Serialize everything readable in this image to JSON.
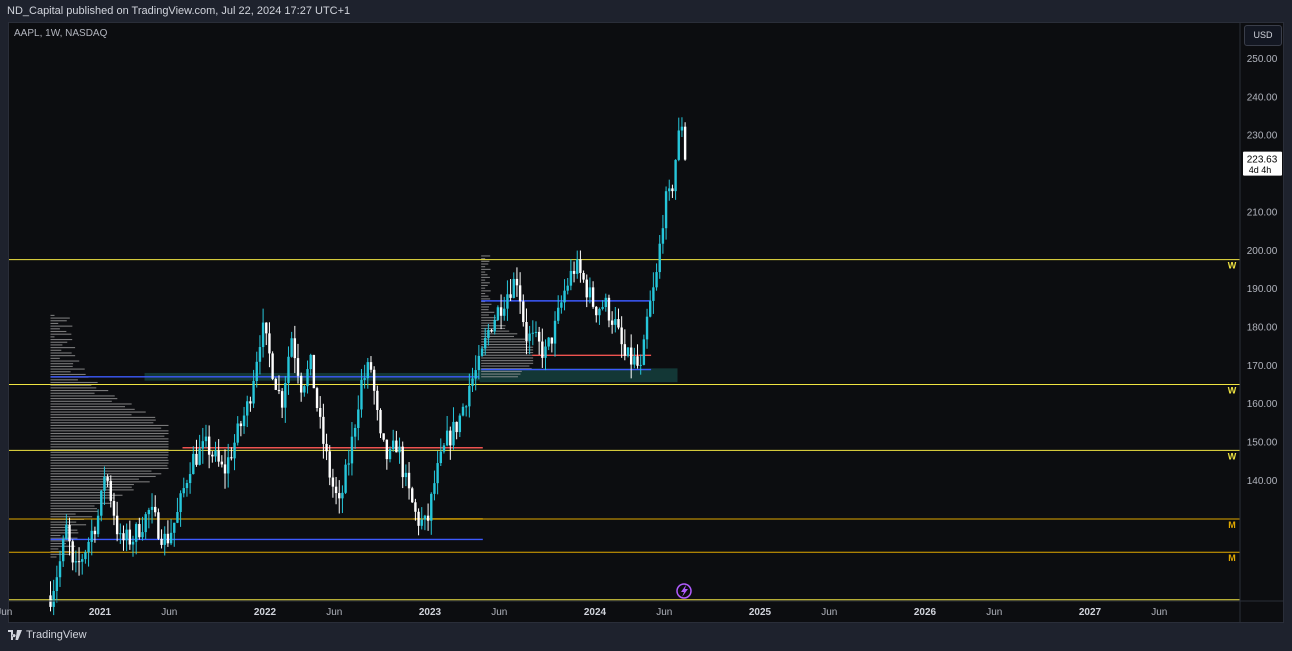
{
  "header": {
    "published_text": "ND_Capital published on TradingView.com, Jul 22, 2024 17:27 UTC+1"
  },
  "symbol": {
    "label": "AAPL, 1W, NASDAQ"
  },
  "currency": "USD",
  "footer": {
    "brand": "TradingView"
  },
  "colors": {
    "up": "#26c6da",
    "down": "#ffffff",
    "yellow_level": "#f0e442",
    "blue_level": "#3d5afe",
    "red_level": "#ef5350",
    "profile": "#9e9e9e",
    "zone": "#26a69a"
  },
  "chart_data": {
    "type": "candlestick",
    "symbol": "AAPL",
    "interval": "1W",
    "exchange": "NASDAQ",
    "ylim": [
      108.86,
      255
    ],
    "price_ticks": [
      140,
      150,
      160,
      170,
      180,
      190,
      200,
      210,
      230,
      240,
      250
    ],
    "price_tick_labels": [
      "140.00",
      "150.00",
      "160.00",
      "170.00",
      "180.00",
      "190.00",
      "200.00",
      "210.00",
      "230.00",
      "240.00",
      "250.00"
    ],
    "time_labels": [
      "Jun",
      "2021",
      "Jun",
      "2022",
      "Jun",
      "2023",
      "Jun",
      "2024",
      "Jun",
      "2025",
      "Jun",
      "2026",
      "Jun",
      "2027",
      "Jun"
    ],
    "time_label_dates": [
      2020.42,
      2021.0,
      2021.42,
      2022.0,
      2022.42,
      2023.0,
      2023.42,
      2024.0,
      2024.42,
      2025.0,
      2025.42,
      2026.0,
      2026.42,
      2027.0,
      2027.42
    ],
    "last_price": {
      "value": 223.63,
      "label": "223.63",
      "countdown": "4d 4h"
    },
    "levels": [
      {
        "price": 197.57,
        "label": "197.57",
        "marker": "W",
        "kind": "yellow"
      },
      {
        "price": 165.0,
        "label": "165.00",
        "marker": "W",
        "kind": "yellow"
      },
      {
        "price": 147.81,
        "label": "147.81",
        "marker": "W",
        "kind": "yellow"
      },
      {
        "price": 129.93,
        "label": "129.93",
        "marker": "M",
        "kind": "orange"
      },
      {
        "price": 121.26,
        "label": "121.26",
        "marker": "M",
        "kind": "orange"
      },
      {
        "price": 108.86,
        "label": "108.86",
        "marker": "",
        "kind": "yellow"
      }
    ],
    "segments": [
      {
        "color": "blue",
        "t0": 2020.7,
        "t1": 2023.3,
        "price": 167.0
      },
      {
        "color": "red",
        "t0": 2021.5,
        "t1": 2023.32,
        "price": 148.5
      },
      {
        "color": "blue",
        "t0": 2020.7,
        "t1": 2023.32,
        "price": 124.6
      },
      {
        "color": "orange",
        "t0": 2022.9,
        "t1": 2023.32,
        "price": 129.93
      },
      {
        "color": "blue",
        "t0": 2023.31,
        "t1": 2024.34,
        "price": 186.8
      },
      {
        "color": "red",
        "t0": 2023.62,
        "t1": 2024.34,
        "price": 172.6
      },
      {
        "color": "blue",
        "t0": 2023.31,
        "t1": 2024.34,
        "price": 168.9
      }
    ],
    "zones": [
      {
        "t0": 2021.27,
        "t1": 2023.3,
        "p0": 166.0,
        "p1": 168.0
      },
      {
        "t0": 2023.3,
        "t1": 2024.5,
        "p0": 165.6,
        "p1": 169.2
      }
    ],
    "volume_profiles": [
      {
        "t0": 2020.7,
        "p_low": 120,
        "p_high": 183,
        "poc": 148.5
      },
      {
        "t0": 2023.31,
        "p_low": 167,
        "p_high": 199,
        "poc": 172.5
      }
    ],
    "price_path": [
      [
        2020.7,
        110
      ],
      [
        2020.76,
        119
      ],
      [
        2020.8,
        128
      ],
      [
        2020.84,
        115
      ],
      [
        2020.9,
        121
      ],
      [
        2021.0,
        132
      ],
      [
        2021.03,
        143
      ],
      [
        2021.07,
        135
      ],
      [
        2021.12,
        124
      ],
      [
        2021.2,
        125
      ],
      [
        2021.3,
        132
      ],
      [
        2021.4,
        124
      ],
      [
        2021.47,
        131
      ],
      [
        2021.55,
        145
      ],
      [
        2021.65,
        149
      ],
      [
        2021.75,
        142
      ],
      [
        2021.9,
        160
      ],
      [
        2021.98,
        180
      ],
      [
        2022.03,
        172
      ],
      [
        2022.1,
        160
      ],
      [
        2022.16,
        178
      ],
      [
        2022.22,
        165
      ],
      [
        2022.28,
        170
      ],
      [
        2022.33,
        155
      ],
      [
        2022.4,
        140
      ],
      [
        2022.45,
        133
      ],
      [
        2022.52,
        148
      ],
      [
        2022.58,
        165
      ],
      [
        2022.64,
        170
      ],
      [
        2022.7,
        150
      ],
      [
        2022.75,
        145
      ],
      [
        2022.8,
        150
      ],
      [
        2022.86,
        138
      ],
      [
        2022.92,
        130
      ],
      [
        2022.98,
        128
      ],
      [
        2023.03,
        140
      ],
      [
        2023.1,
        150
      ],
      [
        2023.17,
        155
      ],
      [
        2023.24,
        165
      ],
      [
        2023.3,
        170
      ],
      [
        2023.36,
        180
      ],
      [
        2023.42,
        185
      ],
      [
        2023.48,
        190
      ],
      [
        2023.53,
        193
      ],
      [
        2023.58,
        178
      ],
      [
        2023.64,
        176
      ],
      [
        2023.7,
        173
      ],
      [
        2023.76,
        180
      ],
      [
        2023.82,
        190
      ],
      [
        2023.88,
        196
      ],
      [
        2023.93,
        192
      ],
      [
        2024.0,
        185
      ],
      [
        2024.06,
        186
      ],
      [
        2024.12,
        181
      ],
      [
        2024.18,
        172
      ],
      [
        2024.24,
        171
      ],
      [
        2024.28,
        168
      ],
      [
        2024.32,
        183
      ],
      [
        2024.37,
        192
      ],
      [
        2024.42,
        212
      ],
      [
        2024.46,
        214
      ],
      [
        2024.5,
        228
      ],
      [
        2024.53,
        234
      ],
      [
        2024.56,
        223.63
      ]
    ]
  }
}
